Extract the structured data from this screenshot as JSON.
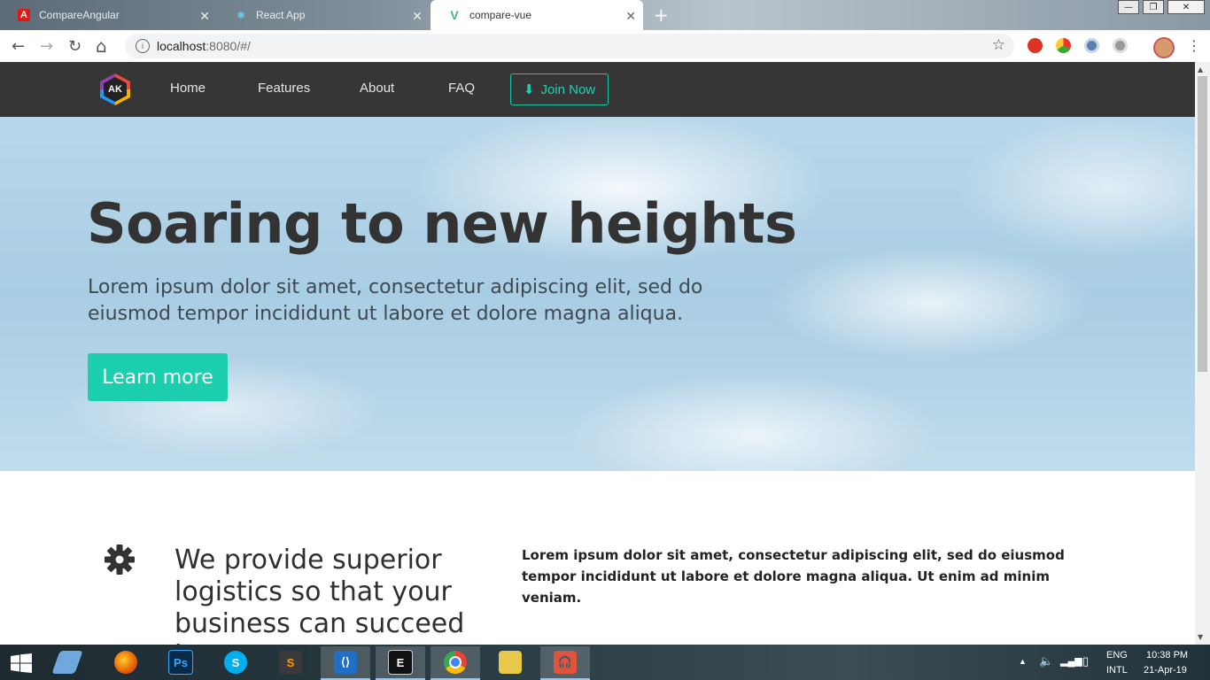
{
  "browser": {
    "tabs": [
      {
        "title": "CompareAngular",
        "close": "✕",
        "favicon_color": "#dd1b16"
      },
      {
        "title": "React App",
        "close": "✕",
        "favicon_color": "#61dafb"
      },
      {
        "title": "compare-vue",
        "close": "✕",
        "favicon_color": "#41b883"
      }
    ],
    "new_tab": "+",
    "window_controls": {
      "minimize": "—",
      "restore": "❐",
      "close": "✕"
    },
    "nav": {
      "back": "←",
      "forward": "→",
      "reload": "↻",
      "home": "⌂"
    },
    "url_host": "localhost",
    "url_path": ":8080/#/",
    "bookmark_icon": "☆",
    "menu": "⋮"
  },
  "site": {
    "logo_text": "AK",
    "nav": [
      "Home",
      "Features",
      "About",
      "FAQ"
    ],
    "join_label": "Join Now",
    "join_icon": "⬇",
    "accent": "#1bcfae",
    "nav_bg": "#363636"
  },
  "hero": {
    "title": "Soaring to new heights",
    "text": "Lorem ipsum dolor sit amet, consectetur adipiscing elit, sed do eiusmod tempor incididunt ut labore et dolore magna aliqua.",
    "button": "Learn more"
  },
  "feature": {
    "title": "We provide superior logistics so that your business can succeed in",
    "text": "Lorem ipsum dolor sit amet, consectetur adipiscing elit, sed do eiusmod tempor incididunt ut labore et dolore magna aliqua. Ut enim ad minim veniam."
  },
  "taskbar": {
    "apps": [
      {
        "name": "desktop-app",
        "label": "",
        "color": "#6fa8dc"
      },
      {
        "name": "firefox",
        "label": "",
        "color": "#e66000"
      },
      {
        "name": "photoshop",
        "label": "Ps",
        "color": "#0b2a4a"
      },
      {
        "name": "skype",
        "label": "S",
        "color": "#00aff0"
      },
      {
        "name": "sublime-text",
        "label": "S",
        "color": "#3a3a3a"
      },
      {
        "name": "vscode",
        "label": "⟨⟩",
        "color": "#1f6fc5"
      },
      {
        "name": "terminal",
        "label": "E",
        "color": "#111"
      },
      {
        "name": "chrome",
        "label": "",
        "color": "#4285f4"
      },
      {
        "name": "file-explorer",
        "label": "",
        "color": "#e8c84a"
      },
      {
        "name": "music-player",
        "label": "🎧",
        "color": "#e0533d"
      }
    ],
    "lang": "ENG",
    "layout": "INTL",
    "time": "10:38 PM",
    "date": "21-Apr-19"
  }
}
